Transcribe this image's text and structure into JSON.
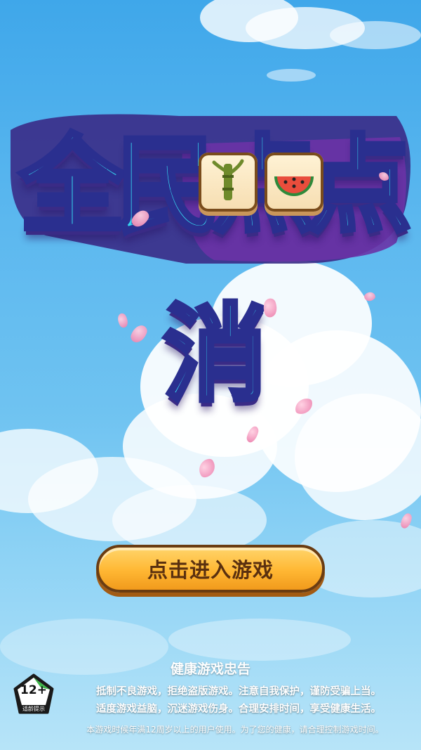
{
  "logo": {
    "title": "全民点点消",
    "tile_icons": [
      "bamboo-icon",
      "watermelon-icon"
    ]
  },
  "start_button": {
    "label": "点击进入游戏"
  },
  "health_advisory": {
    "title": "健康游戏忠告",
    "lines": [
      "抵制不良游戏，拒绝盗版游戏。注意自我保护，谨防受骗上当。",
      "适度游戏益脑，沉迷游戏伤身。合理安排时间，享受健康生活。"
    ],
    "age_note": "本游戏时候年满12周岁以上的用户使用。为了您的健康，请合理控制游戏时间。"
  },
  "age_rating": {
    "value": "12+",
    "label": "适龄提示"
  },
  "colors": {
    "sky_top": "#3fa7ea",
    "button_orange": "#ffb733",
    "button_text": "#5a300f",
    "logo_cyan": "#36d3ee",
    "logo_orange": "#ffb733",
    "logo_outline": "#2a2f8f",
    "petal_pink": "#f39cc0"
  }
}
